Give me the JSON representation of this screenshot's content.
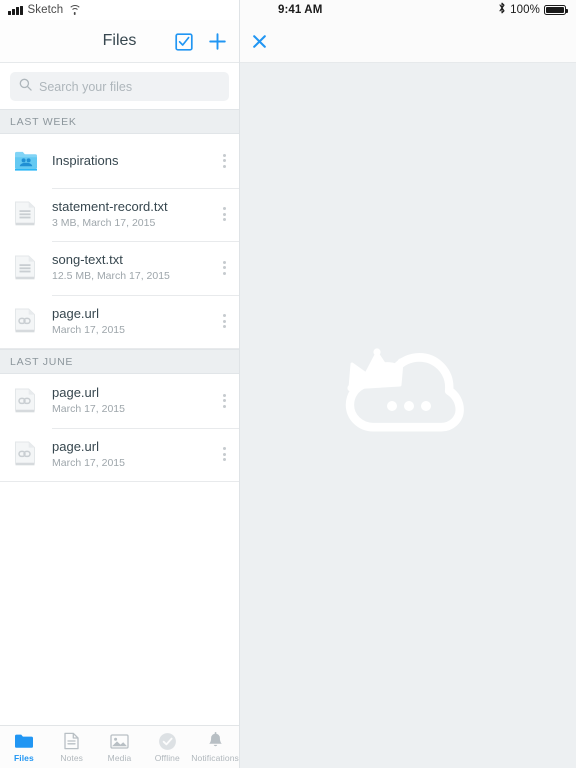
{
  "status_bar_left": {
    "carrier": "Sketch",
    "signal_icon": "signal-bars-icon",
    "wifi_icon": "wifi-icon"
  },
  "status_bar_right": {
    "time": "9:41 AM",
    "bluetooth_icon": "bluetooth-icon",
    "battery_percent": "100%",
    "battery_icon": "battery-full-icon"
  },
  "navbar": {
    "title": "Files",
    "select_label": "select-checkbox-icon",
    "add_label": "plus-icon",
    "accent_color": "#2196f3"
  },
  "search": {
    "placeholder": "Search your files",
    "value": "",
    "icon": "search-icon"
  },
  "sections": [
    {
      "title": "LAST WEEK",
      "items": [
        {
          "name": "Inspirations",
          "meta": "",
          "icon": "shared-folder-icon",
          "menu": "overflow-menu-icon"
        },
        {
          "name": "statement-record.txt",
          "meta": "3 MB, March 17, 2015",
          "icon": "text-file-icon",
          "menu": "overflow-menu-icon"
        },
        {
          "name": "song-text.txt",
          "meta": "12.5 MB, March 17, 2015",
          "icon": "text-file-icon",
          "menu": "overflow-menu-icon"
        },
        {
          "name": "page.url",
          "meta": "March 17, 2015",
          "icon": "link-file-icon",
          "menu": "overflow-menu-icon"
        }
      ]
    },
    {
      "title": "LAST JUNE",
      "items": [
        {
          "name": "page.url",
          "meta": "March 17, 2015",
          "icon": "link-file-icon",
          "menu": "overflow-menu-icon"
        },
        {
          "name": "page.url",
          "meta": "March 17, 2015",
          "icon": "link-file-icon",
          "menu": "overflow-menu-icon"
        }
      ]
    }
  ],
  "tabbar": {
    "tabs": [
      {
        "label": "Files",
        "icon": "folder-icon",
        "active": true
      },
      {
        "label": "Notes",
        "icon": "note-icon",
        "active": false
      },
      {
        "label": "Media",
        "icon": "photo-icon",
        "active": false
      },
      {
        "label": "Offline",
        "icon": "offline-check-icon",
        "active": false
      },
      {
        "label": "Notifications",
        "icon": "bell-icon",
        "active": false
      }
    ]
  },
  "detail_panel": {
    "close_label": "close-icon",
    "empty_illustration": "crowned-cloud-icon",
    "background_color": "#edf0f2"
  }
}
